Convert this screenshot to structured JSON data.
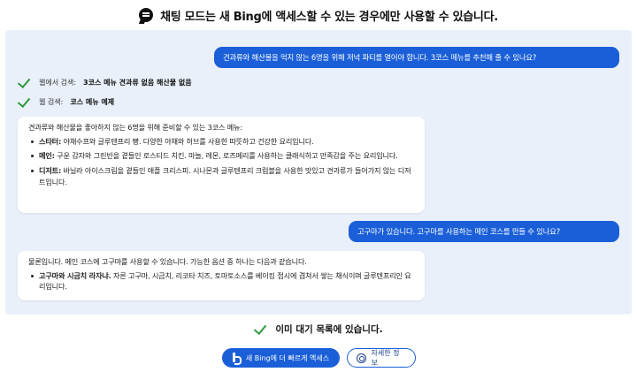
{
  "header": {
    "icon": "chat-bubble-icon",
    "title": "채팅 모드는 새 Bing에 액세스할 수 있는 경우에만 사용할 수 있습니다."
  },
  "colors": {
    "accent": "#1a5fd8",
    "panel_bg": "#eaf0fa",
    "check": "#2e9a3e"
  },
  "conversation": {
    "user_message_1": "견과류와 해산물을 먹지 않는 6명을 위해 저녁 파티를 열어야 합니다. 3코스 메뉴를 추천해 줄 수 있나요?",
    "searches": [
      {
        "prefix": "웹에서 검색:",
        "query": "3코스 메뉴 견과류 없음 해산물 없음"
      },
      {
        "prefix": "웹 검색:",
        "query": "코스 메뉴 예제"
      }
    ],
    "bot_message_1": {
      "intro": "견과류와 해산물을 좋아하지 않는 6명을 위해 준비할 수 있는 3코스 메뉴:",
      "items": [
        {
          "label": "스타터:",
          "text": "야채수프와 글루텐프리 빵. 다양한 야채와 허브를 사용한 따뜻하고 건강한 요리입니다."
        },
        {
          "label": "메인:",
          "text": "구운 감자와 그린빈을 곁들인 로스티드 치킨. 마늘, 레몬, 로즈메리를 사용하는 클래식하고 만족감을 주는 요리입니다."
        },
        {
          "label": "디저트:",
          "text": "바닐라 아이스크림을 곁들인 애플 크리스피. 시나몬과 글루텐프리 크럼블을 사용한 맛있고 견과류가 들어가지 않는 디저트입니다."
        }
      ]
    },
    "user_message_2": "고구마가 있습니다. 고구마를 사용하는 메인 코스를 만들 수 있나요?",
    "bot_message_2": {
      "intro": "물론입니다. 메인 코스에 고구마를 사용할 수 있습니다. 가능한 옵션 중 하나는 다음과 같습니다.",
      "items": [
        {
          "label": "고구마와 시금치 라자냐.",
          "text": "자른 고구마, 시금치, 리코타 치즈, 토마토소스를 베이킹 접시에 겹쳐서 쌓는 채식이며 글루텐프리인 요리입니다."
        }
      ]
    }
  },
  "waitlist": {
    "icon": "check-icon",
    "text": "이미 대기 목록에 있습니다."
  },
  "actions": {
    "primary_label": "새 Bing에 더 빠르게 액세스",
    "secondary_label": "자세한 정보"
  }
}
